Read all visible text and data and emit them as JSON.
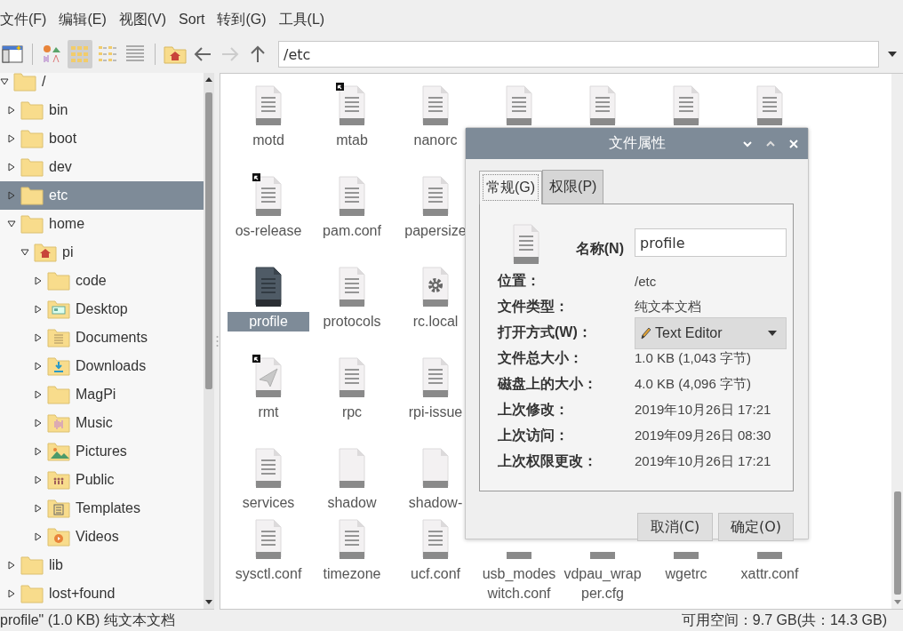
{
  "menubar": [
    "文件(F)",
    "编辑(E)",
    "视图(V)",
    "Sort",
    "转到(G)",
    "工具(L)"
  ],
  "toolbar": {
    "view_modes": [
      {
        "kind": "thumbnails",
        "selected": false
      },
      {
        "kind": "icons",
        "selected": true
      },
      {
        "kind": "compact",
        "selected": false
      },
      {
        "kind": "list",
        "selected": false
      }
    ],
    "nav_buttons": [
      {
        "kind": "back",
        "disabled": false
      },
      {
        "kind": "forward",
        "disabled": true
      },
      {
        "kind": "up",
        "disabled": false
      }
    ],
    "path": {
      "value": "/etc"
    }
  },
  "sidebar": {
    "tree": [
      {
        "name": "/",
        "kind": "folder",
        "expanded": true,
        "selected": false,
        "children": [
          {
            "name": "bin",
            "kind": "folder",
            "expanded": false,
            "selected": false
          },
          {
            "name": "boot",
            "kind": "folder",
            "expanded": false,
            "selected": false
          },
          {
            "name": "dev",
            "kind": "folder",
            "expanded": false,
            "selected": false
          },
          {
            "name": "etc",
            "kind": "folder",
            "expanded": false,
            "selected": true
          },
          {
            "name": "home",
            "kind": "folder",
            "expanded": true,
            "selected": false,
            "children": [
              {
                "name": "pi",
                "kind": "home",
                "expanded": true,
                "selected": false,
                "children": [
                  {
                    "name": "code",
                    "kind": "folder",
                    "expanded": false,
                    "selected": false
                  },
                  {
                    "name": "Desktop",
                    "kind": "desktop",
                    "expanded": false,
                    "selected": false
                  },
                  {
                    "name": "Documents",
                    "kind": "documents",
                    "expanded": false,
                    "selected": false
                  },
                  {
                    "name": "Downloads",
                    "kind": "downloads",
                    "expanded": false,
                    "selected": false
                  },
                  {
                    "name": "MagPi",
                    "kind": "folder",
                    "expanded": false,
                    "selected": false
                  },
                  {
                    "name": "Music",
                    "kind": "music",
                    "expanded": false,
                    "selected": false
                  },
                  {
                    "name": "Pictures",
                    "kind": "pictures",
                    "expanded": false,
                    "selected": false
                  },
                  {
                    "name": "Public",
                    "kind": "public",
                    "expanded": false,
                    "selected": false
                  },
                  {
                    "name": "Templates",
                    "kind": "templates",
                    "expanded": false,
                    "selected": false
                  },
                  {
                    "name": "Videos",
                    "kind": "videos",
                    "expanded": false,
                    "selected": false
                  }
                ]
              }
            ]
          },
          {
            "name": "lib",
            "kind": "folder",
            "expanded": false,
            "selected": false
          },
          {
            "name": "lost+found",
            "kind": "folder",
            "expanded": false,
            "selected": false
          }
        ]
      }
    ]
  },
  "files": {
    "rows": [
      [
        {
          "name": "motd",
          "kind": "text",
          "link": false,
          "selected": false
        },
        {
          "name": "mtab",
          "kind": "text",
          "link": true,
          "selected": false
        },
        {
          "name": "nanorc",
          "kind": "text",
          "link": false,
          "selected": false
        },
        {
          "kind": "text",
          "link": false
        },
        {
          "kind": "text",
          "link": false
        },
        {
          "kind": "text",
          "link": false
        },
        {
          "kind": "text",
          "link": false
        }
      ],
      [
        {
          "name": "os-release",
          "kind": "text",
          "link": true,
          "selected": false
        },
        {
          "name": "pam.conf",
          "kind": "text",
          "link": false,
          "selected": false
        },
        {
          "name": "papersize",
          "kind": "text",
          "link": false,
          "selected": false
        }
      ],
      [
        {
          "name": "profile",
          "kind": "text",
          "link": false,
          "selected": true
        },
        {
          "name": "protocols",
          "kind": "text",
          "link": false,
          "selected": false
        },
        {
          "name": "rc.local",
          "kind": "gear",
          "link": false,
          "selected": false
        }
      ],
      [
        {
          "name": "rmt",
          "kind": "plane",
          "link": true,
          "selected": false
        },
        {
          "name": "rpc",
          "kind": "text",
          "link": false,
          "selected": false
        },
        {
          "name": "rpi-issue",
          "kind": "text",
          "link": false,
          "selected": false
        }
      ],
      [
        {
          "name": "services",
          "kind": "text",
          "link": false,
          "selected": false
        },
        {
          "name": "shadow",
          "kind": "blank",
          "link": false,
          "selected": false
        },
        {
          "name": "shadow-",
          "kind": "blank",
          "link": false,
          "selected": false
        }
      ],
      [
        {
          "name": "sysctl.conf",
          "kind": "text",
          "link": false,
          "selected": false
        },
        {
          "name": "timezone",
          "kind": "text",
          "link": false,
          "selected": false
        },
        {
          "name": "ucf.conf",
          "kind": "text",
          "link": false,
          "selected": false
        },
        {
          "name": "usb_modeswitch.conf",
          "selected": false
        },
        {
          "name": "vdpau_wrapper.cfg",
          "selected": false
        },
        {
          "name": "wgetrc",
          "selected": false
        },
        {
          "name": "xattr.conf",
          "selected": false
        }
      ]
    ]
  },
  "dialog": {
    "title": "文件属性",
    "tabs": [
      {
        "label": "常规(G)",
        "selected": true
      },
      {
        "label": "权限(P)",
        "selected": false
      }
    ],
    "name_label": "名称(N)",
    "name_value": "profile",
    "properties": [
      {
        "kind": "text",
        "label": "位置：",
        "value": "/etc"
      },
      {
        "kind": "text",
        "label": "文件类型：",
        "value": "纯文本文档"
      },
      {
        "kind": "combo",
        "label": "打开方式(W)：",
        "value": "Text Editor"
      },
      {
        "kind": "text",
        "label": "文件总大小：",
        "value": "1.0 KB (1,043 字节)"
      },
      {
        "kind": "text",
        "label": "磁盘上的大小：",
        "value": "4.0 KB (4,096 字节)"
      },
      {
        "kind": "text",
        "label": "上次修改：",
        "value": "2019年10月26日 17:21"
      },
      {
        "kind": "text",
        "label": "上次访问：",
        "value": "2019年09月26日 08:30"
      },
      {
        "kind": "text",
        "label": "上次权限更改：",
        "value": "2019年10月26日 17:21"
      }
    ],
    "buttons": [
      "取消(C)",
      "确定(O)"
    ]
  },
  "status_bar": {
    "selection": "profile\" (1.0 KB) 纯文本文档",
    "free_space": "可用空间：9.7 GB(共：14.3 GB)"
  }
}
